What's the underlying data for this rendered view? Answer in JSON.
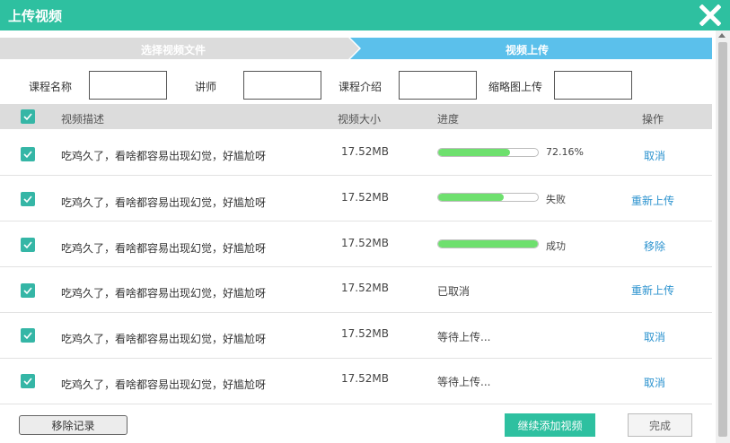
{
  "dialog": {
    "title": "上传视频",
    "close_icon": "close-x-icon"
  },
  "steps": [
    {
      "label": "选择视频文件",
      "state": "done"
    },
    {
      "label": "视频上传",
      "state": "active"
    }
  ],
  "form": {
    "course_name_label": "课程名称",
    "course_name_value": "",
    "lecturer_label": "讲师",
    "lecturer_value": "",
    "intro_label": "课程介绍",
    "intro_value": "",
    "thumbnail_label": "缩略图上传",
    "thumbnail_value": ""
  },
  "table": {
    "headers": {
      "desc": "视频描述",
      "size": "视频大小",
      "progress": "进度",
      "action": "操作"
    },
    "rows": [
      {
        "desc": "吃鸡久了，看啥都容易出现幻觉，好尴尬呀",
        "size": "17.52MB",
        "progress": 0.7216,
        "progress_text": "72.16%",
        "status": "",
        "action": "取消",
        "checked": true
      },
      {
        "desc": "吃鸡久了，看啥都容易出现幻觉，好尴尬呀",
        "size": "17.52MB",
        "progress": 0.66,
        "progress_text": "失败",
        "status": "",
        "action": "重新上传",
        "checked": true
      },
      {
        "desc": "吃鸡久了，看啥都容易出现幻觉，好尴尬呀",
        "size": "17.52MB",
        "progress": 1.0,
        "progress_text": "成功",
        "status": "",
        "action": "移除",
        "checked": true
      },
      {
        "desc": "吃鸡久了，看啥都容易出现幻觉，好尴尬呀",
        "size": "17.52MB",
        "progress": null,
        "progress_text": "",
        "status": "已取消",
        "action": "重新上传",
        "checked": true
      },
      {
        "desc": "吃鸡久了，看啥都容易出现幻觉，好尴尬呀",
        "size": "17.52MB",
        "progress": null,
        "progress_text": "",
        "status": "等待上传...",
        "action": "取消",
        "checked": true
      },
      {
        "desc": "吃鸡久了，看啥都容易出现幻觉，好尴尬呀",
        "size": "17.52MB",
        "progress": null,
        "progress_text": "",
        "status": "等待上传...",
        "action": "取消",
        "checked": true
      }
    ]
  },
  "footer": {
    "remove_records": "移除记录",
    "continue_add": "继续添加视频",
    "done": "完成"
  },
  "colors": {
    "brand": "#2ec0a0",
    "step_active": "#5bc0eb",
    "progress_fill": "#6ee06e",
    "link": "#2c93cf"
  }
}
